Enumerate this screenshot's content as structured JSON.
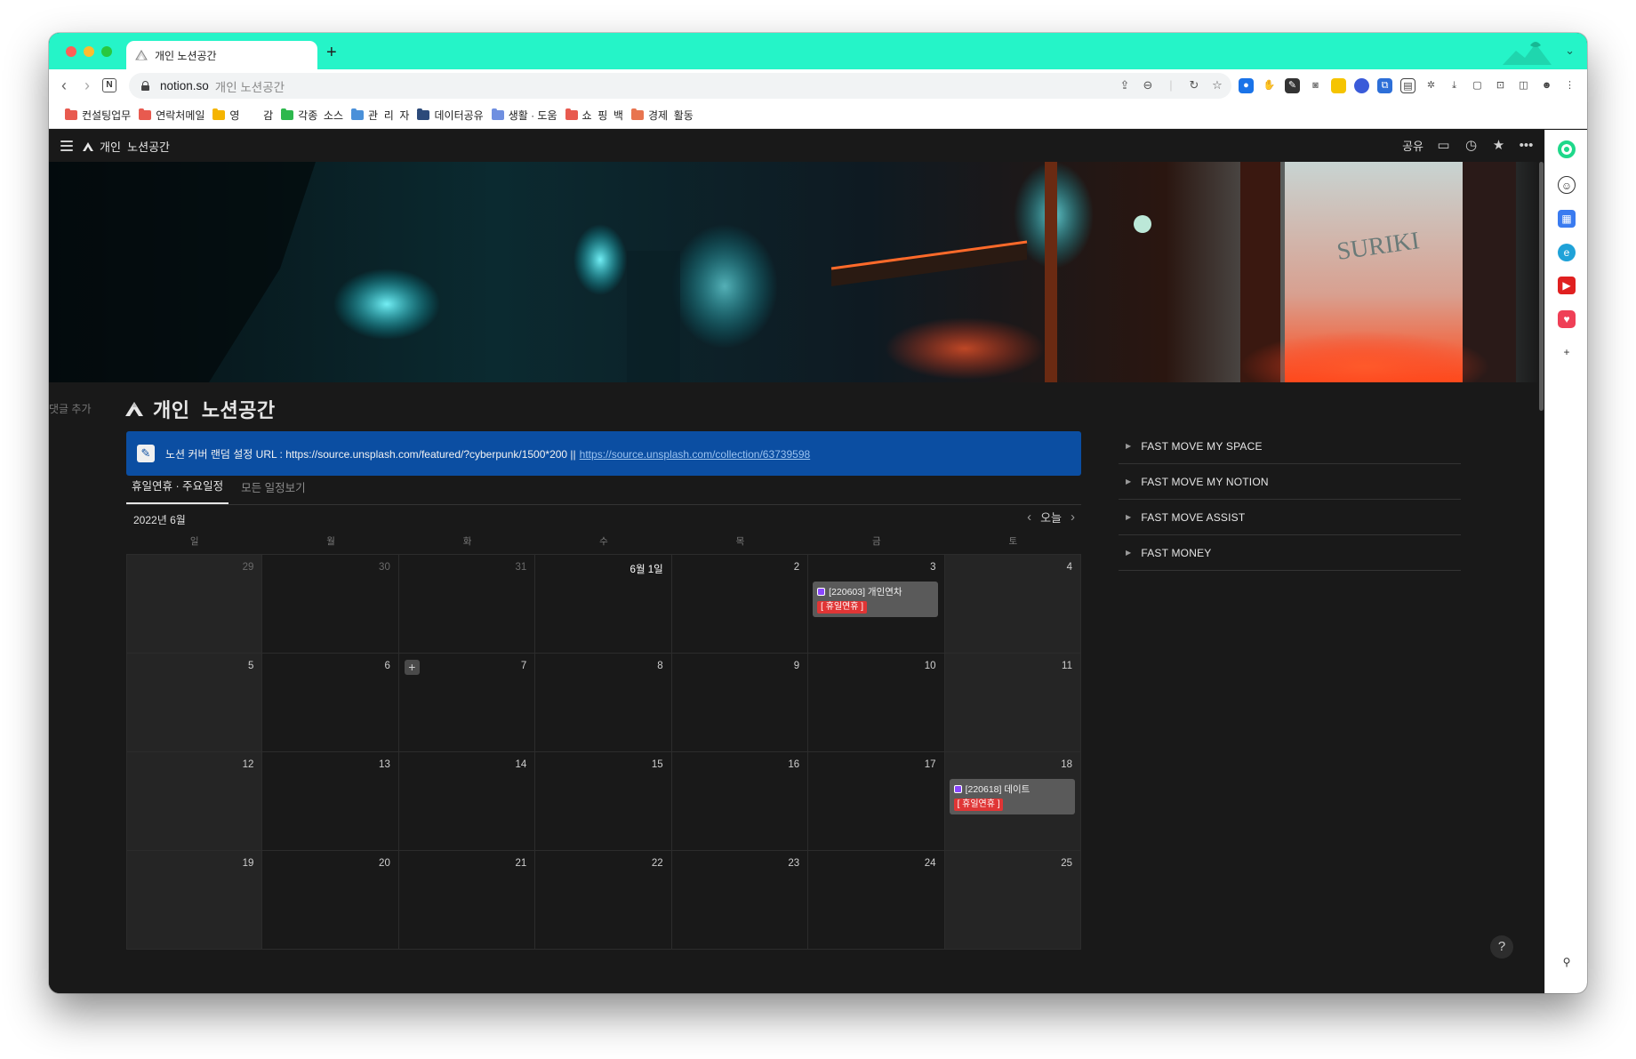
{
  "browser": {
    "tab_title": "개인  노션공간",
    "new_tab": "+",
    "url_host": "notion.so",
    "url_path": "개인  노션공간",
    "nav_n": "N"
  },
  "bookmarks": [
    {
      "label": "컨설팅업무",
      "color": "#e85a4f"
    },
    {
      "label": "연락처메일",
      "color": "#e85a4f"
    },
    {
      "label": "영        감",
      "color": "#f5b400"
    },
    {
      "label": "각종  소스",
      "color": "#2db84d"
    },
    {
      "label": "관  리  자",
      "color": "#4a90d9"
    },
    {
      "label": "데이터공유",
      "color": "#2c4a7a"
    },
    {
      "label": "생활 · 도움",
      "color": "#6f8fe0"
    },
    {
      "label": "쇼  핑  백",
      "color": "#e85a4f"
    },
    {
      "label": "경제  활동",
      "color": "#e8744f"
    }
  ],
  "notion": {
    "breadcrumb": "개인  노션공간",
    "share": "공유",
    "add_comment": "댓글 추가",
    "page_title": "개인  노션공간",
    "callout": {
      "text": "노션 커버 랜덤 설정 URL : https://source.unsplash.com/featured/?cyberpunk/1500*200 ||",
      "link": "https://source.unsplash.com/collection/63739598"
    },
    "view_tabs": [
      {
        "label": "휴일연휴 · 주요일정",
        "active": true
      },
      {
        "label": "모든 일정보기",
        "active": false
      }
    ],
    "calendar": {
      "month": "2022년 6월",
      "today": "오늘",
      "weekdays": [
        "일",
        "월",
        "화",
        "수",
        "목",
        "금",
        "토"
      ],
      "weeks": [
        [
          "29",
          "30",
          "31",
          "6월 1일",
          "2",
          "3",
          "4"
        ],
        [
          "5",
          "6",
          "7",
          "8",
          "9",
          "10",
          "11"
        ],
        [
          "12",
          "13",
          "14",
          "15",
          "16",
          "17",
          "18"
        ],
        [
          "19",
          "20",
          "21",
          "22",
          "23",
          "24",
          "25"
        ]
      ],
      "events": [
        {
          "title": "[220603] 개인연차",
          "tag": "[ 휴일연휴 ]"
        },
        {
          "title": "[220618] 데이트",
          "tag": "[ 휴일연휴 ]"
        }
      ]
    },
    "toggles": [
      "FAST MOVE MY SPACE",
      "FAST MOVE MY NOTION",
      "FAST MOVE ASSIST",
      "FAST MONEY"
    ],
    "help": "?"
  }
}
